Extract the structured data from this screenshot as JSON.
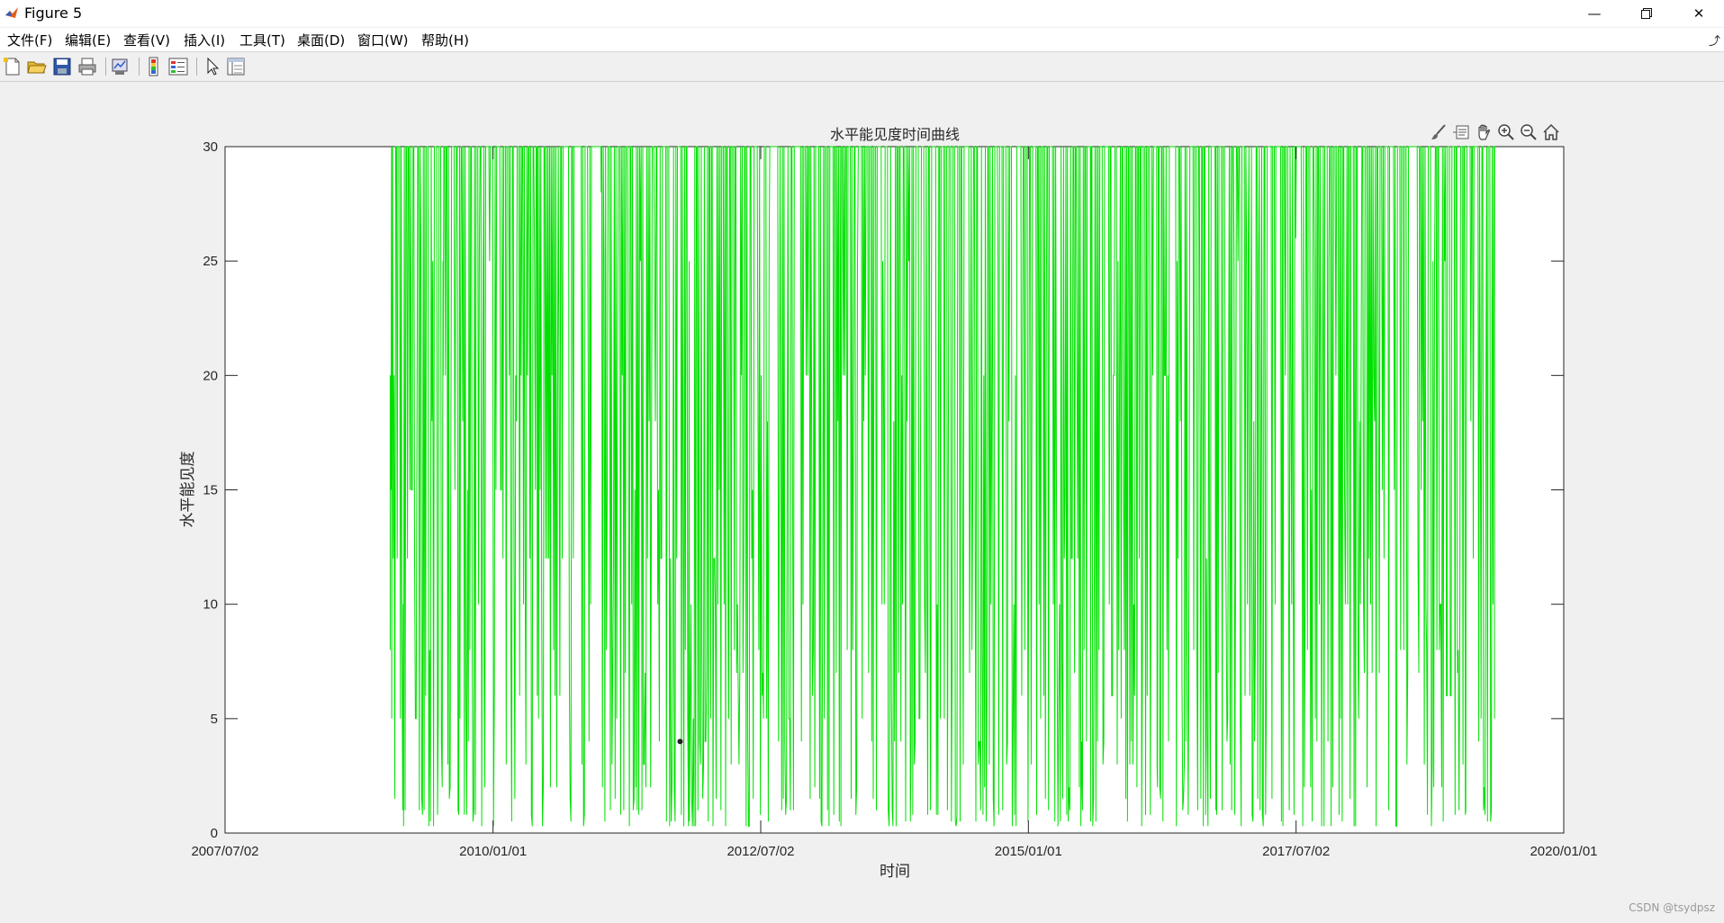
{
  "window": {
    "title": "Figure 5"
  },
  "menu": [
    "文件(F)",
    "编辑(E)",
    "查看(V)",
    "插入(I)",
    "工具(T)",
    "桌面(D)",
    "窗口(W)",
    "帮助(H)"
  ],
  "toolbar_icons": [
    "new-figure-icon",
    "open-file-icon",
    "save-icon",
    "print-icon",
    "link-icon",
    "colorbar-icon",
    "legend-icon",
    "edit-plot-icon",
    "property-inspector-icon"
  ],
  "axes_toolbar_icons": [
    "brush-icon",
    "data-tip-icon",
    "pan-icon",
    "zoom-in-icon",
    "zoom-out-icon",
    "home-icon"
  ],
  "watermark": "CSDN @tsydpsz",
  "colors": {
    "series": "#00e000",
    "axes": "#262626",
    "background": "#f0f0f0"
  },
  "chart_data": {
    "type": "line",
    "title": "水平能见度时间曲线",
    "xlabel": "时间",
    "ylabel": "水平能见度",
    "x_range": [
      "2007-07-02",
      "2020-01-01"
    ],
    "x_ticks": [
      "2007/07/02",
      "2010/01/01",
      "2012/07/02",
      "2015/01/01",
      "2017/07/02",
      "2020/01/01"
    ],
    "ylim": [
      0,
      30
    ],
    "y_ticks": [
      "0",
      "5",
      "10",
      "15",
      "20",
      "25",
      "30"
    ],
    "grid": false,
    "legend": "none",
    "series": [
      {
        "color": "#00e000",
        "data_start": "2009-01-15",
        "data_end": "2019-05-10",
        "min": 0.2,
        "max": 30,
        "samples_x": [
          "2009-01-15",
          "2009-01-20",
          "2009-02-01",
          "2009-03-01",
          "2009-05-10",
          "2009-07-15",
          "2009-09-10",
          "2009-12-01",
          "2010-06-01",
          "2011-01-05",
          "2011-06-01",
          "2011-11-01",
          "2012-07-01",
          "2013-04-01",
          "2014-02-01",
          "2014-09-01",
          "2015-08-01",
          "2016-03-15",
          "2016-10-01",
          "2017-07-01",
          "2018-03-01",
          "2018-12-01",
          "2019-02-01",
          "2019-05-10"
        ],
        "samples_y": [
          20,
          30,
          12,
          10,
          7,
          20,
          5,
          30,
          6,
          28,
          3,
          25,
          2,
          18,
          1,
          27,
          0.5,
          3,
          1,
          26,
          2,
          30,
          1,
          5
        ]
      }
    ],
    "annotation_point": {
      "x": "2011-10-01",
      "y": 4
    }
  }
}
